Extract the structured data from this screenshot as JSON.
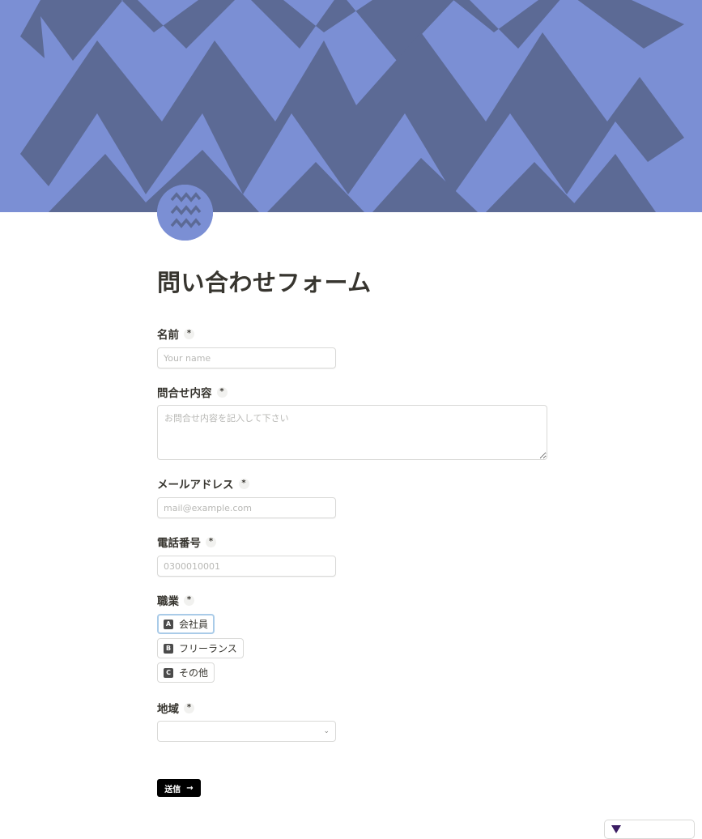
{
  "banner": {
    "colors": {
      "light": "#7b8fd4",
      "dark": "#5c6a95"
    }
  },
  "form": {
    "title": "問い合わせフォーム",
    "required_mark": "*",
    "fields": {
      "name": {
        "label": "名前",
        "placeholder": "Your name",
        "value": ""
      },
      "inquiry": {
        "label": "問合せ内容",
        "placeholder": "お問合せ内容を記入して下さい",
        "value": ""
      },
      "email": {
        "label": "メールアドレス",
        "placeholder": "mail@example.com",
        "value": ""
      },
      "phone": {
        "label": "電話番号",
        "placeholder": "0300010001",
        "value": ""
      },
      "occupation": {
        "label": "職業",
        "options": [
          {
            "key": "A",
            "label": "会社員",
            "selected": true
          },
          {
            "key": "B",
            "label": "フリーランス",
            "selected": false
          },
          {
            "key": "C",
            "label": "その他",
            "selected": false
          }
        ]
      },
      "region": {
        "label": "地域",
        "selected_value": ""
      }
    },
    "submit": {
      "label": "送信",
      "icon": "arrow-right-icon",
      "arrow": "→"
    }
  },
  "colors": {
    "accent_selected_border": "#a9cbe8",
    "submit_bg": "#000000",
    "text": "#37352f"
  }
}
